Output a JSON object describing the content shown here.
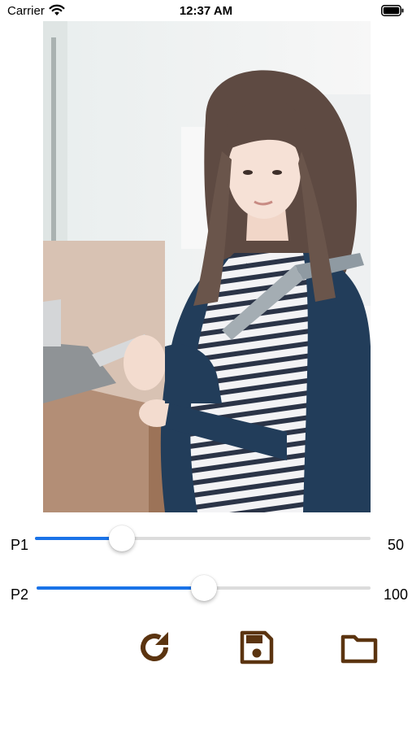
{
  "status_bar": {
    "carrier": "Carrier",
    "time": "12:37 AM"
  },
  "photo": {
    "icon": "photo-of-woman-with-phone"
  },
  "sliders": [
    {
      "label": "P1",
      "value_text": "50",
      "fill_fraction": 0.26
    },
    {
      "label": "P2",
      "value_text": "100",
      "fill_fraction": 0.5
    }
  ],
  "toolbar": {
    "icons": [
      "rotate-icon",
      "save-icon",
      "folder-icon"
    ]
  },
  "colors": {
    "accent": "#1a73e8",
    "icon_brown": "#5b3410",
    "track": "#dcdcdc"
  }
}
